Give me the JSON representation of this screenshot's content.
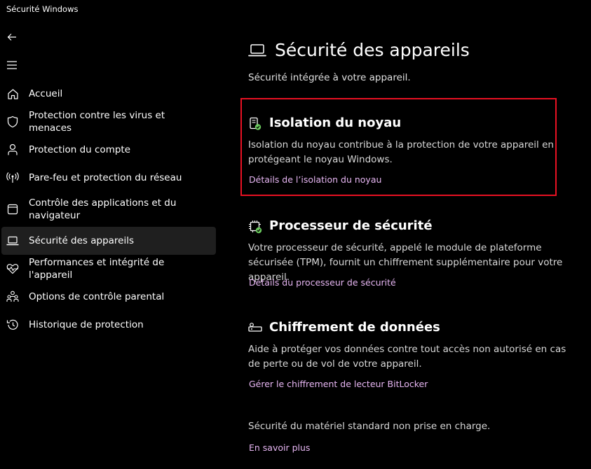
{
  "window": {
    "title": "Sécurité Windows"
  },
  "nav": {
    "back_icon": "back-arrow-icon",
    "menu_icon": "hamburger-menu-icon"
  },
  "sidebar": {
    "items": [
      {
        "label": "Accueil",
        "icon": "home-icon"
      },
      {
        "label": "Protection contre les virus et menaces",
        "icon": "shield-icon"
      },
      {
        "label": "Protection du compte",
        "icon": "person-icon"
      },
      {
        "label": "Pare-feu et protection du réseau",
        "icon": "antenna-icon"
      },
      {
        "label": "Contrôle des applications et du navigateur",
        "icon": "browser-icon"
      },
      {
        "label": "Sécurité des appareils",
        "icon": "laptop-icon",
        "active": true
      },
      {
        "label": "Performances et intégrité de l'appareil",
        "icon": "heart-pulse-icon"
      },
      {
        "label": "Options de contrôle parental",
        "icon": "family-icon"
      },
      {
        "label": "Historique de protection",
        "icon": "history-icon"
      }
    ]
  },
  "main": {
    "title": "Sécurité des appareils",
    "subtitle": "Sécurité intégrée à votre appareil.",
    "sections": [
      {
        "title": "Isolation du noyau",
        "description": "Isolation du noyau contribue à la protection de votre appareil en protégeant le noyau Windows.",
        "link": "Détails de l’isolation du noyau",
        "icon": "core-isolation-icon"
      },
      {
        "title": "Processeur de sécurité",
        "description": "Votre processeur de sécurité, appelé le module de plateforme sécurisée (TPM), fournit un chiffrement supplémentaire pour votre appareil.",
        "link": "Détails du processeur de sécurité",
        "icon": "chip-icon"
      },
      {
        "title": "Chiffrement de données",
        "description": "Aide à protéger vos données contre tout accès non autorisé en cas de perte ou de vol de votre appareil.",
        "link": "Gérer le chiffrement de lecteur BitLocker",
        "icon": "key-icon"
      }
    ],
    "footer": {
      "text": "Sécurité du matériel standard non prise en charge.",
      "link": "En savoir plus"
    }
  },
  "colors": {
    "background": "#000000",
    "link": "#e7b6f3",
    "highlight_border": "#e81123",
    "status_ok": "#6ccb5f"
  }
}
